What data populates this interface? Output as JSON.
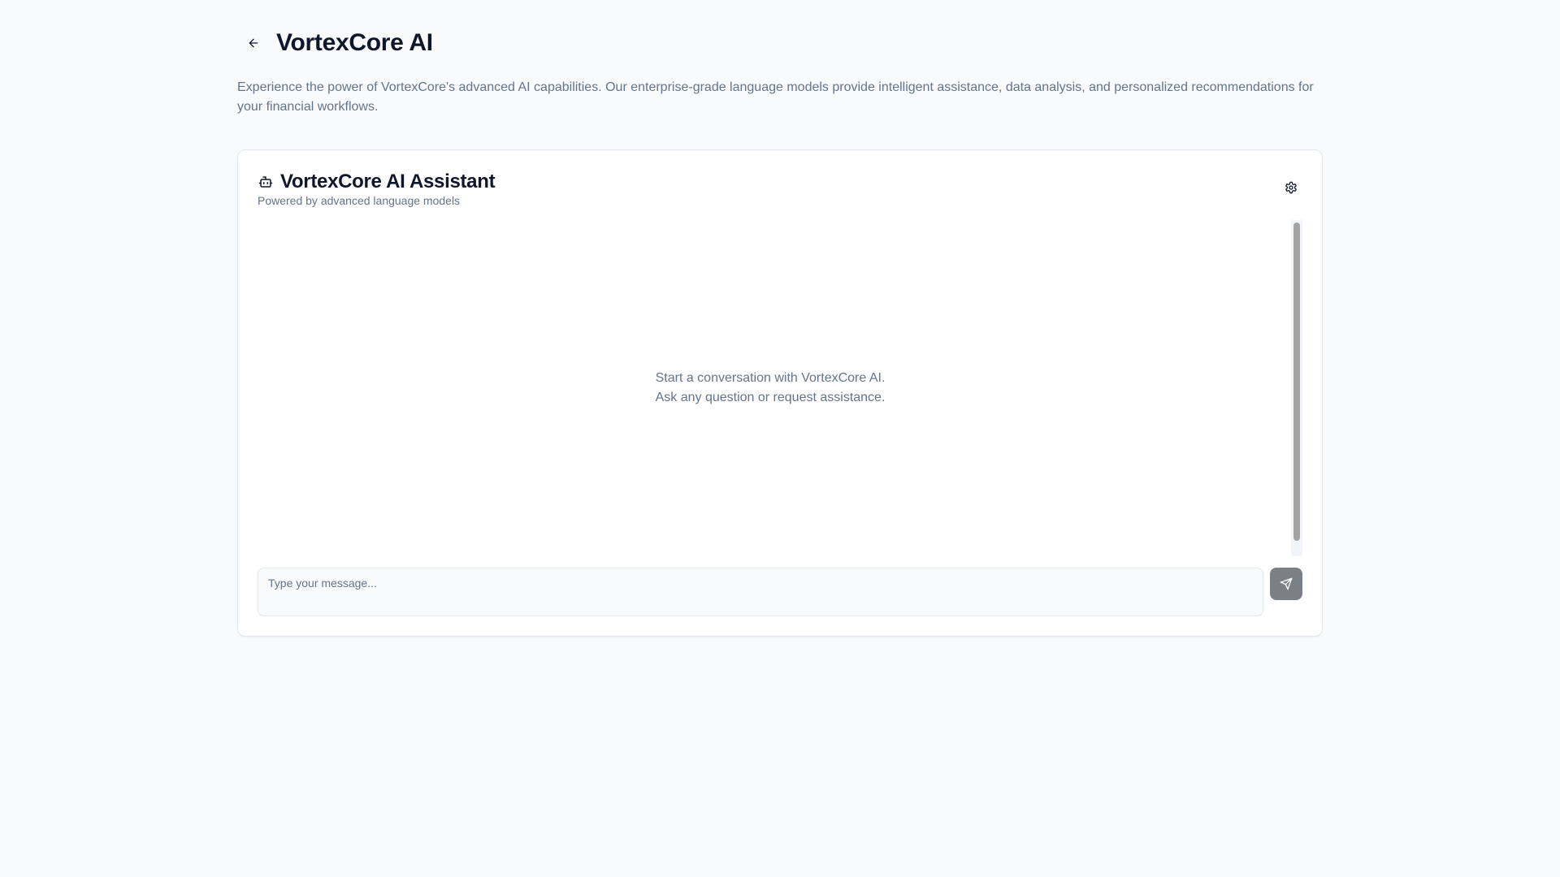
{
  "header": {
    "title": "VortexCore AI",
    "back_icon": "arrow-left-icon"
  },
  "description": "Experience the power of VortexCore's advanced AI capabilities. Our enterprise-grade language models provide intelligent assistance, data analysis, and personalized recommendations for your financial workflows.",
  "assistant": {
    "title": "VortexCore AI Assistant",
    "subtitle": "Powered by advanced language models",
    "icon": "bot-icon",
    "settings_icon": "gear-icon",
    "empty_state": {
      "line1": "Start a conversation with VortexCore AI.",
      "line2": "Ask any question or request assistance."
    },
    "input": {
      "value": "",
      "placeholder": "Type your message..."
    },
    "send_icon": "send-icon",
    "send_button_color": "#7b7f86"
  },
  "colors": {
    "background": "#f8fafc",
    "text_primary": "#0f172a",
    "text_muted": "#64748b",
    "border": "#e2e8f0"
  }
}
